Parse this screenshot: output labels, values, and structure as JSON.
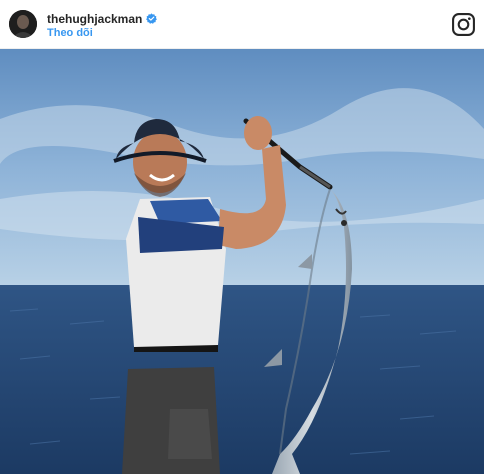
{
  "header": {
    "username": "thehughjackman",
    "verified_icon": "verified-badge-icon",
    "follow_label": "Theo dõi",
    "logo_icon": "instagram-logo-icon"
  },
  "photo": {
    "subject": "fishing-photo"
  },
  "colors": {
    "accent": "#3897f0",
    "text": "#262626",
    "sky": "#7aa3cc",
    "sea": "#2a4e7d"
  }
}
